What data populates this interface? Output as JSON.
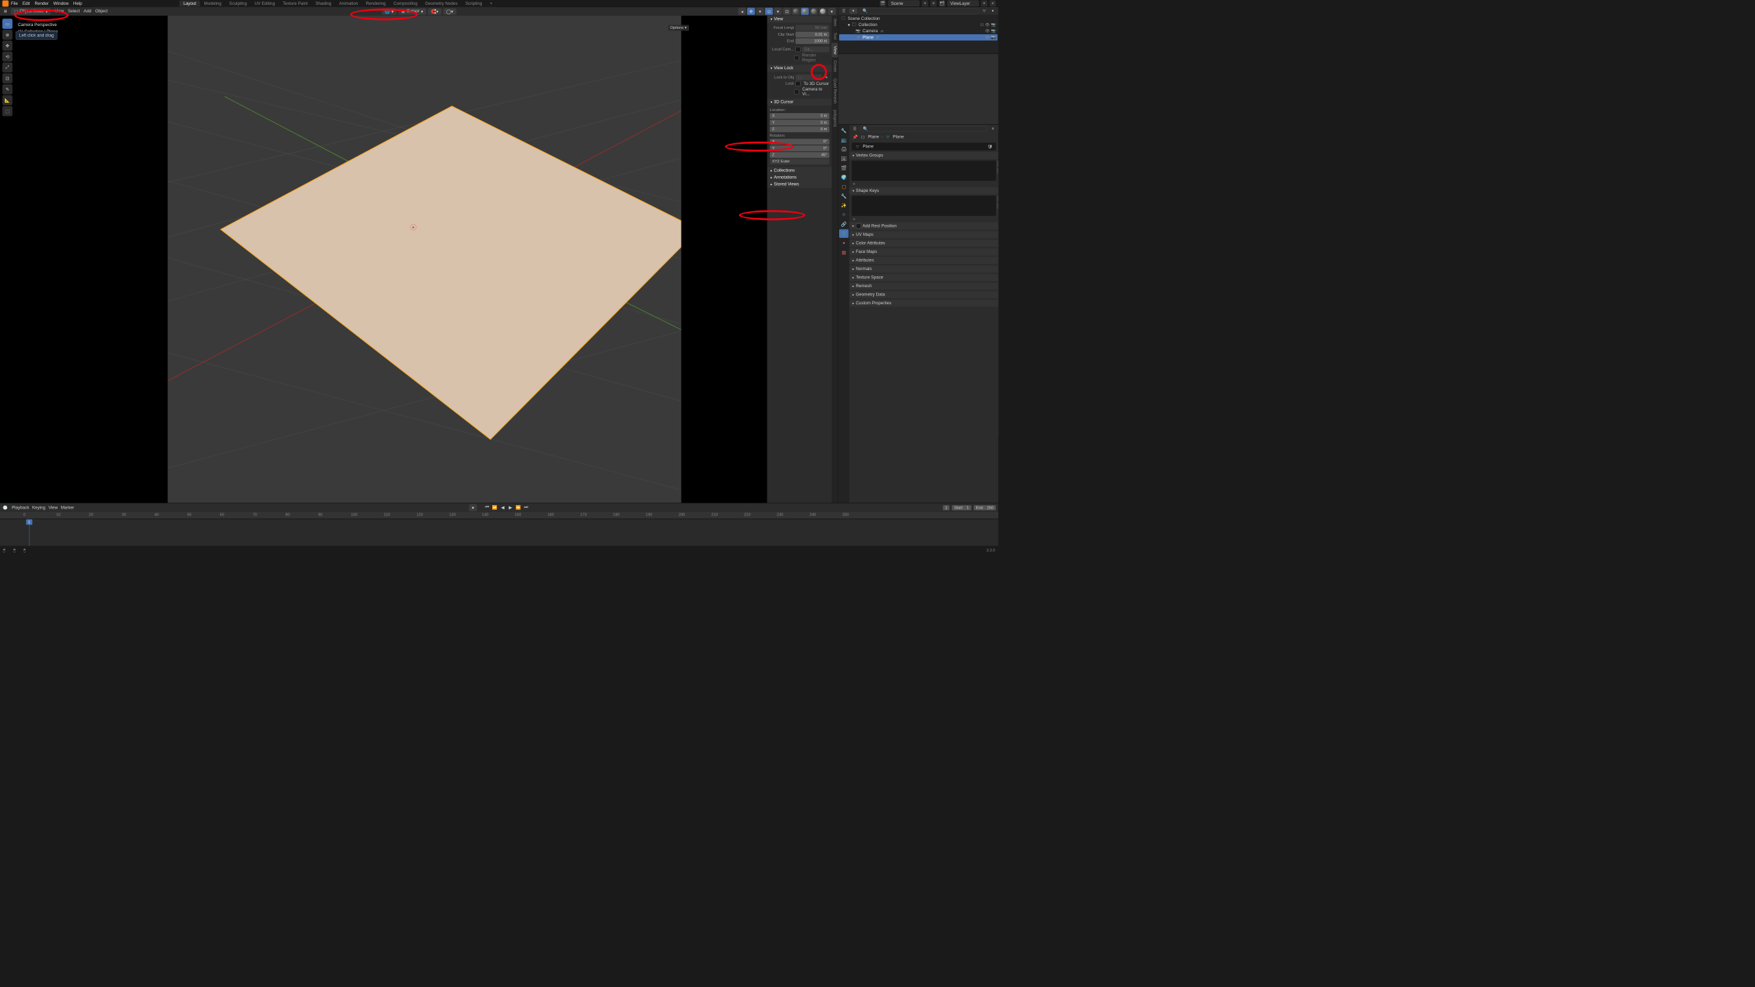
{
  "topmenu": [
    "File",
    "Edit",
    "Render",
    "Window",
    "Help"
  ],
  "workspaces": [
    "Layout",
    "Modeling",
    "Sculpting",
    "UV Editing",
    "Texture Paint",
    "Shading",
    "Animation",
    "Rendering",
    "Compositing",
    "Geometry Nodes",
    "Scripting"
  ],
  "scene_label": "Scene",
  "viewlayer_label": "ViewLayer",
  "mode": "Object Mode",
  "vp_menus": [
    "View",
    "Select",
    "Add",
    "Object"
  ],
  "pivot_label": "Cursor",
  "overlay_title": "Camera Perspective",
  "overlay_sub": "(1) Collection | Plane",
  "info_bubble": "Left click and drag",
  "npanel_tabs": [
    "Item",
    "Tool",
    "View",
    "Create",
    "Quad Remesh",
    "polygoniq"
  ],
  "view": {
    "title": "View",
    "focal_label": "Focal Lengt",
    "focal_val": "50 mm",
    "clip_start_label": "Clip Start",
    "clip_start_val": "0.01 m",
    "clip_end_label": "End",
    "clip_end_val": "1000 m",
    "local_cam_label": "Local Cam...",
    "local_cam_val": "Ca...",
    "render_region": "Render Region"
  },
  "viewlock": {
    "title": "View Lock",
    "lock_to_obj": "Lock to Obj",
    "lock_label": "Lock",
    "to3dcursor": "To 3D Cursor",
    "camtoview": "Camera to Vi..."
  },
  "cursor3d": {
    "title": "3D Cursor",
    "location": "Location:",
    "rotation": "Rotation:",
    "x": "X",
    "y": "Y",
    "z": "Z",
    "loc_x": "0 m",
    "loc_y": "0 m",
    "loc_z": "0 m",
    "rot_x": "0°",
    "rot_y": "0°",
    "rot_z": "45°",
    "rot_mode": "XYZ Euler"
  },
  "np_sections": [
    "Collections",
    "Annotations",
    "Stored Views"
  ],
  "options_label": "Options",
  "outliner": {
    "scene_collection": "Scene Collection",
    "collection": "Collection",
    "camera": "Camera",
    "plane": "Plane"
  },
  "properties": {
    "breadcrumb_obj": "Plane",
    "breadcrumb_data": "Plane",
    "obj_name": "Plane",
    "sections": [
      "Vertex Groups",
      "Shape Keys",
      "Add Rest Position",
      "UV Maps",
      "Color Attributes",
      "Face Maps",
      "Attributes",
      "Normals",
      "Texture Space",
      "Remesh",
      "Geometry Data",
      "Custom Properties"
    ]
  },
  "timeline": {
    "menus": [
      "Playback",
      "Keying",
      "View",
      "Marker"
    ],
    "frame": "1",
    "start_label": "Start",
    "start_val": "1",
    "end_label": "End",
    "end_val": "250",
    "ticks": [
      0,
      10,
      20,
      30,
      40,
      50,
      60,
      70,
      80,
      90,
      100,
      110,
      120,
      130,
      140,
      150,
      160,
      170,
      180,
      190,
      200,
      210,
      220,
      230,
      240,
      250
    ]
  },
  "version": "3.3.0"
}
